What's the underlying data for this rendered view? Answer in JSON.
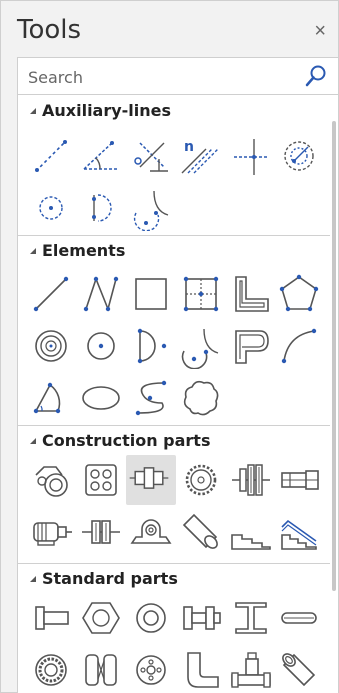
{
  "panel": {
    "title": "Tools",
    "close_glyph": "×"
  },
  "search": {
    "placeholder": "Search",
    "value": ""
  },
  "colors": {
    "accent": "#2a59b2",
    "icon_gray": "#555555",
    "selected_bg": "#e0e0e0"
  },
  "sections": [
    {
      "label": "Auxiliary-lines",
      "items": [
        "diagonal-dotted-line-icon",
        "angle-line-icon",
        "perpendicular-line-icon",
        "parallel-lines-n-icon",
        "crosshair-icon",
        "circle-construction-icon",
        "center-point-circle-icon",
        "tangent-arc-icon",
        "arc-point-icon"
      ]
    },
    {
      "label": "Elements",
      "items": [
        "line-icon",
        "polyline-icon",
        "rectangle-icon",
        "point-grid-icon",
        "l-shape-icon",
        "pentagon-icon",
        "concentric-circles-icon",
        "circle-center-icon",
        "segment-shape-icon",
        "arc-tangent-icon",
        "outline-shape-icon",
        "arc-icon",
        "sector-icon",
        "ellipse-icon",
        "spline-icon",
        "cloud-icon"
      ]
    },
    {
      "label": "Construction parts",
      "items": [
        "bearing-eye-icon",
        "dotted-plate-icon",
        "coupling-icon",
        "gear-icon",
        "spring-clutch-icon",
        "cylinder-housing-icon",
        "motor-icon",
        "shaft-coupling-icon",
        "pillow-block-icon",
        "shaft-icon",
        "stairs-icon",
        "stairs-rail-icon"
      ],
      "selected": 2
    },
    {
      "label": "Standard parts",
      "items": [
        "bolt-icon",
        "hex-nut-icon",
        "washer-icon",
        "stud-bolt-icon",
        "i-beam-icon",
        "pin-icon",
        "ball-bearing-icon",
        "shaft-sleeve-icon",
        "disc-bearing-icon",
        "pipe-elbow-icon",
        "pipe-tee-icon",
        "pipe-icon"
      ]
    }
  ]
}
